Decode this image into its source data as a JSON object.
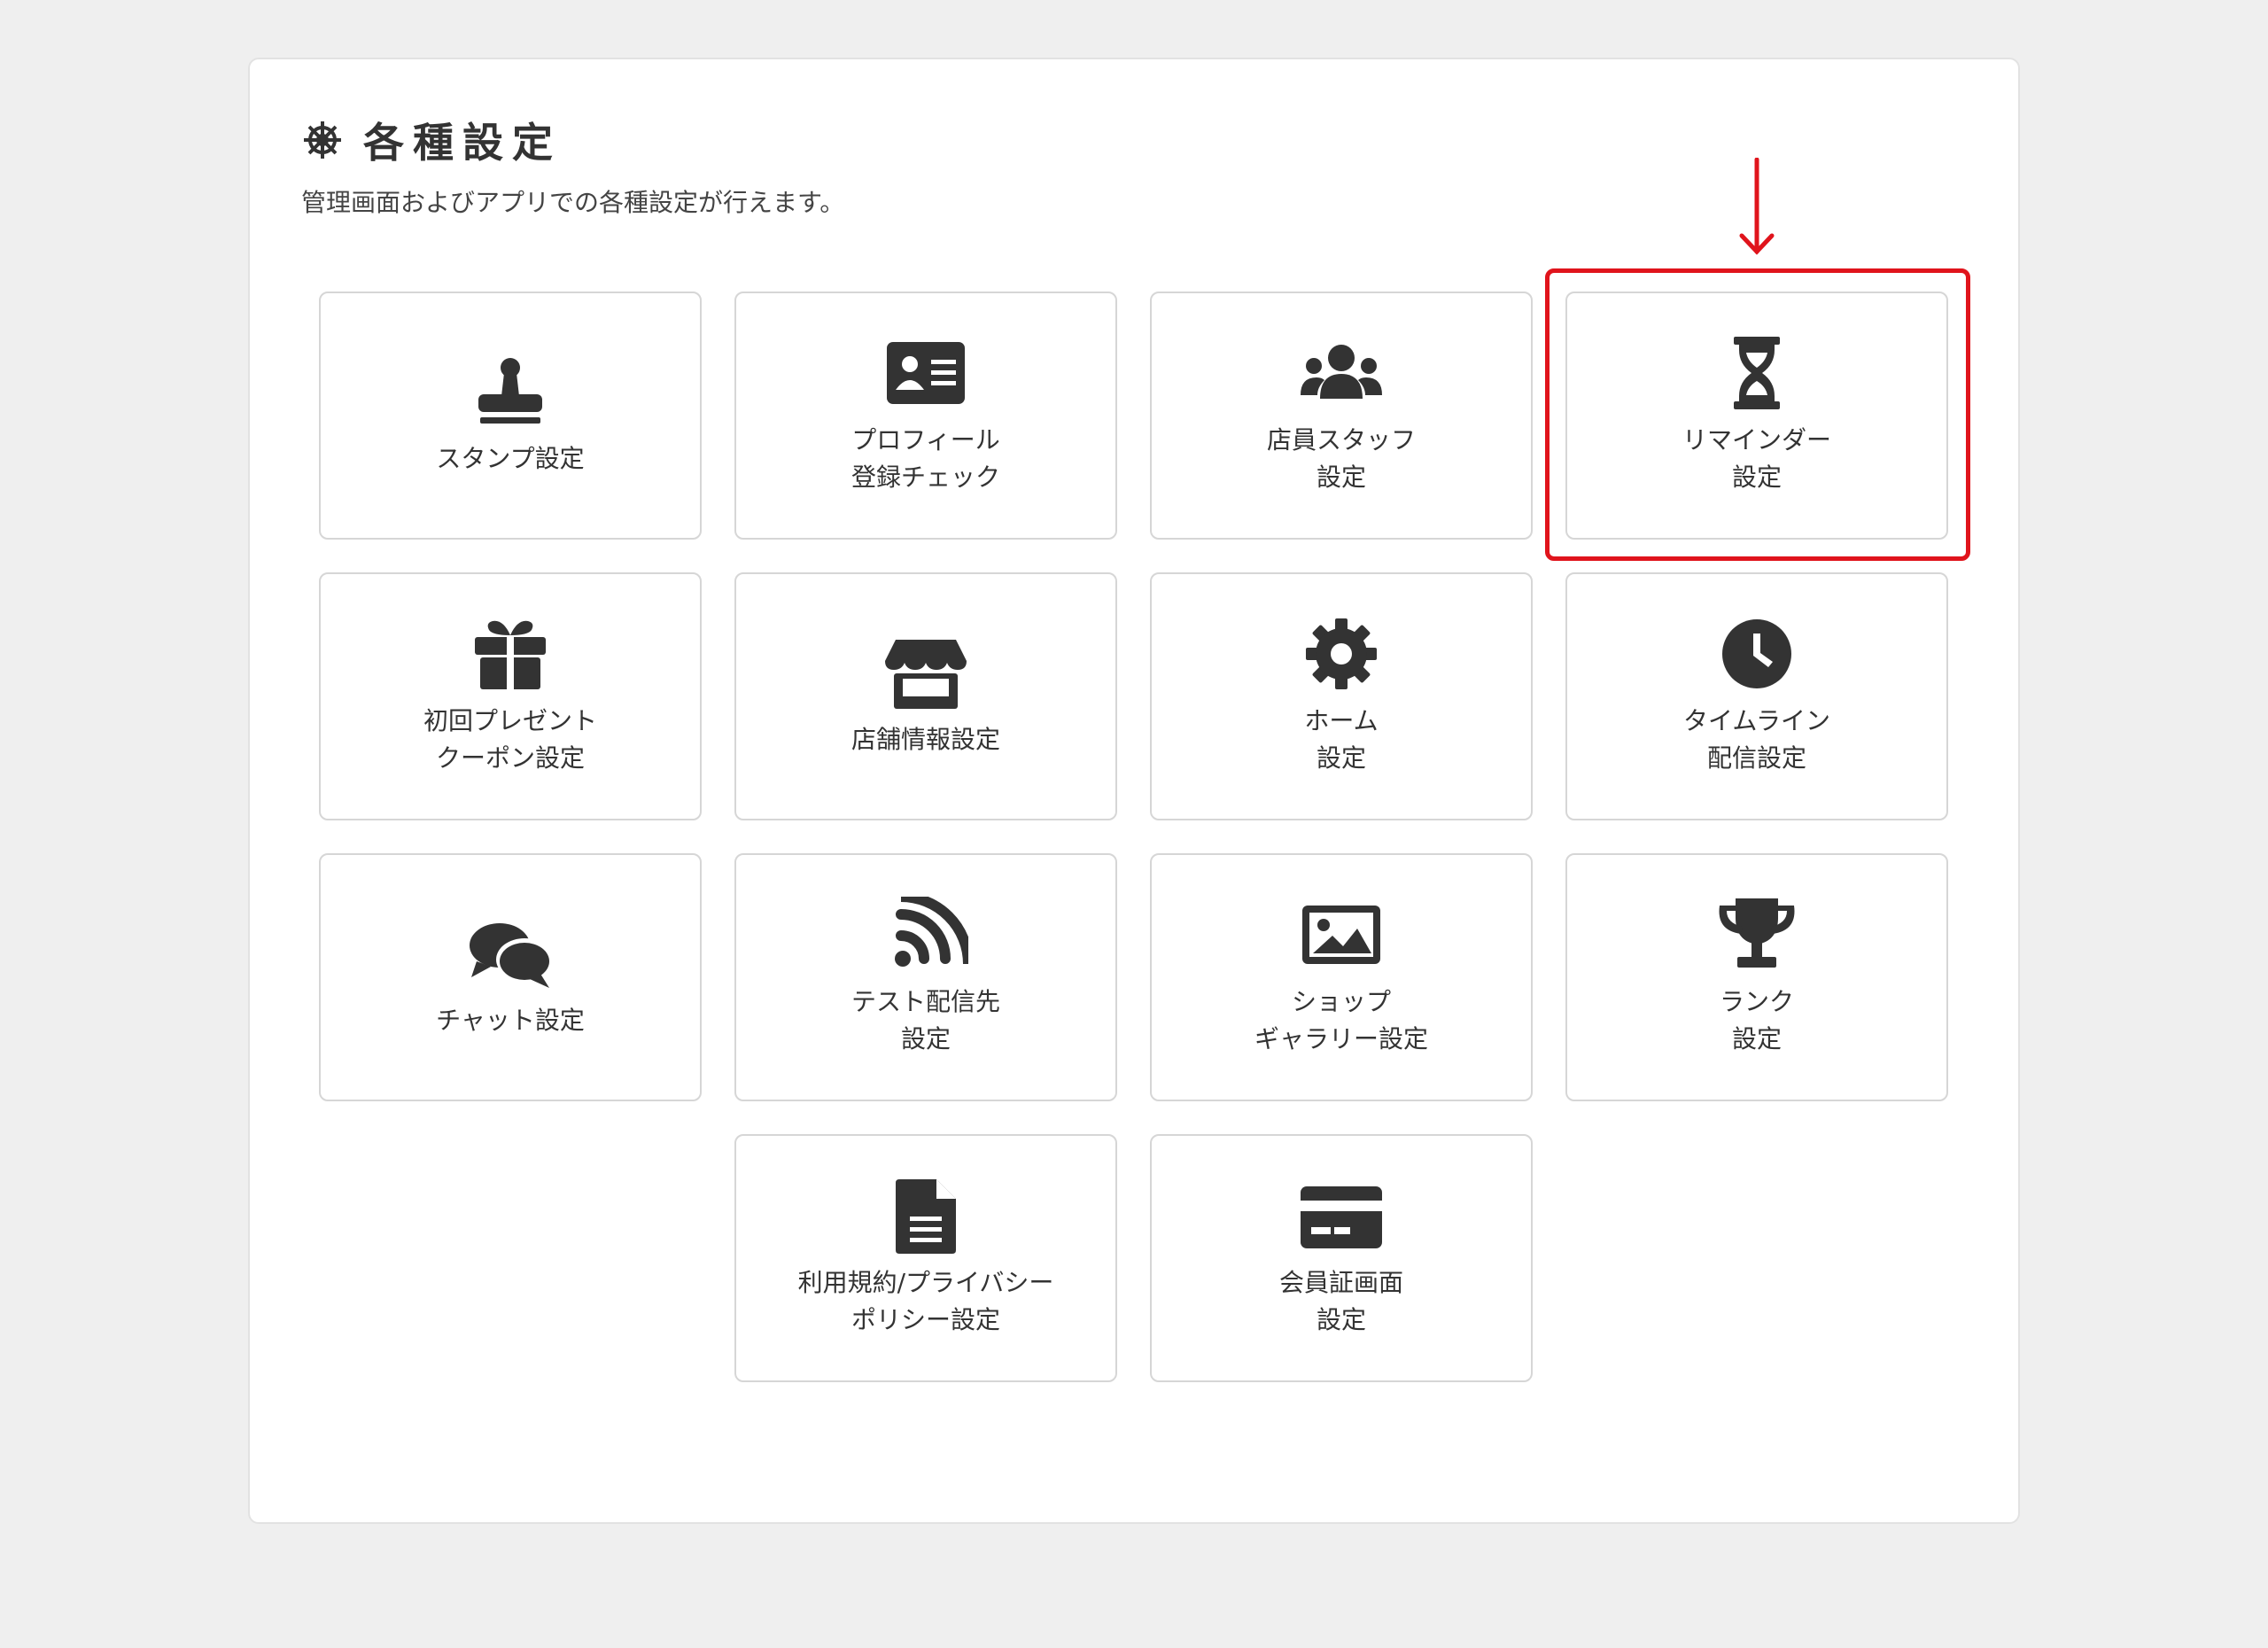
{
  "header": {
    "title": "各種設定",
    "description": "管理画面およびアプリでの各種設定が行えます。",
    "icon": "helm-gear-icon"
  },
  "highlight": {
    "target": "reminder",
    "color": "#e0141c"
  },
  "cards": [
    {
      "id": "stamp",
      "icon": "stamp-icon",
      "lines": [
        "スタンプ設定"
      ]
    },
    {
      "id": "profile",
      "icon": "id-card-icon",
      "lines": [
        "プロフィール",
        "登録チェック"
      ]
    },
    {
      "id": "staff",
      "icon": "users-icon",
      "lines": [
        "店員スタッフ",
        "設定"
      ]
    },
    {
      "id": "reminder",
      "icon": "hourglass-icon",
      "lines": [
        "リマインダー",
        "設定"
      ]
    },
    {
      "id": "first-coupon",
      "icon": "gift-icon",
      "lines": [
        "初回プレゼント",
        "クーポン設定"
      ]
    },
    {
      "id": "shop-info",
      "icon": "store-icon",
      "lines": [
        "店舗情報設定"
      ]
    },
    {
      "id": "home",
      "icon": "gear-icon",
      "lines": [
        "ホーム",
        "設定"
      ]
    },
    {
      "id": "timeline",
      "icon": "clock-icon",
      "lines": [
        "タイムライン",
        "配信設定"
      ]
    },
    {
      "id": "chat",
      "icon": "chat-bubbles-icon",
      "lines": [
        "チャット設定"
      ]
    },
    {
      "id": "test-delivery",
      "icon": "rss-icon",
      "lines": [
        "テスト配信先",
        "設定"
      ]
    },
    {
      "id": "shop-gallery",
      "icon": "image-icon",
      "lines": [
        "ショップ",
        "ギャラリー設定"
      ]
    },
    {
      "id": "rank",
      "icon": "trophy-icon",
      "lines": [
        "ランク",
        "設定"
      ]
    },
    {
      "id": "terms",
      "icon": "document-icon",
      "lines": [
        "利用規約/プライバシー",
        "ポリシー設定"
      ]
    },
    {
      "id": "member-card",
      "icon": "credit-card-icon",
      "lines": [
        "会員証画面",
        "設定"
      ]
    }
  ]
}
